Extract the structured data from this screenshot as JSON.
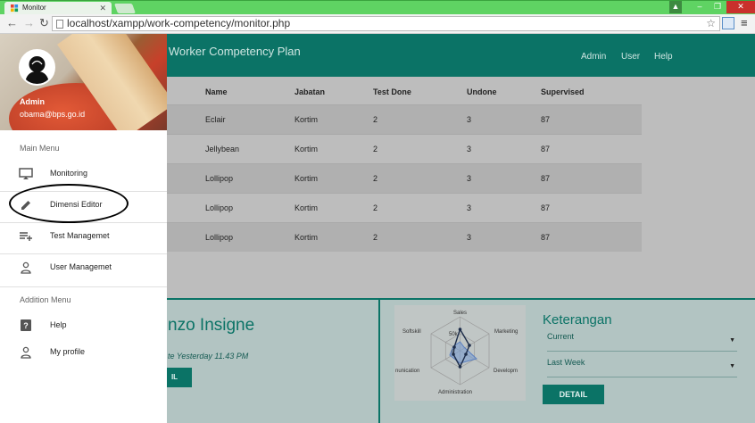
{
  "browser": {
    "tab_title": "Monitor",
    "url": "localhost/xampp/work-competency/monitor.php"
  },
  "appbar": {
    "title": "e Worker Competency Plan",
    "nav": [
      "Admin",
      "User",
      "Help"
    ]
  },
  "table": {
    "headers": [
      "Name",
      "Jabatan",
      "Test Done",
      "Undone",
      "Supervised"
    ],
    "rows": [
      [
        "Eclair",
        "Kortim",
        "2",
        "3",
        "87"
      ],
      [
        "Jellybean",
        "Kortim",
        "2",
        "3",
        "87"
      ],
      [
        "Lollipop",
        "Kortim",
        "2",
        "3",
        "87"
      ],
      [
        "Lollipop",
        "Kortim",
        "2",
        "3",
        "87"
      ],
      [
        "Lollipop",
        "Kortim",
        "2",
        "3",
        "87"
      ]
    ]
  },
  "profile_card": {
    "name": "nzo Insigne",
    "subtitle": "te Yesterday 11.43 PM",
    "button_label": "IL"
  },
  "radar": {
    "labels": [
      "Sales",
      "Marketing",
      "Developm",
      "Administration",
      "nunication",
      "Softskill"
    ],
    "tick_label": "50k",
    "center_label": "0"
  },
  "keterangan": {
    "title": "Keterangan",
    "select1": "Current",
    "select2": "Last Week",
    "button_label": "DETAIL"
  },
  "drawer": {
    "user_name": "Admin",
    "user_email": "obama@bps.go.id",
    "main_menu_title": "Main Menu",
    "main_menu": [
      {
        "label": "Monitoring",
        "icon": "monitor-icon"
      },
      {
        "label": "Dimensi Editor",
        "icon": "pencil-icon"
      },
      {
        "label": "Test Managemet",
        "icon": "playlist-add-icon"
      },
      {
        "label": "User Managemet",
        "icon": "person-icon"
      }
    ],
    "addition_menu_title": "Addition Menu",
    "addition_menu": [
      {
        "label": "Help",
        "icon": "help-icon"
      },
      {
        "label": "My profile",
        "icon": "person-icon"
      }
    ]
  },
  "colors": {
    "primary": "#0b7366",
    "titlebar": "#5fd363"
  }
}
